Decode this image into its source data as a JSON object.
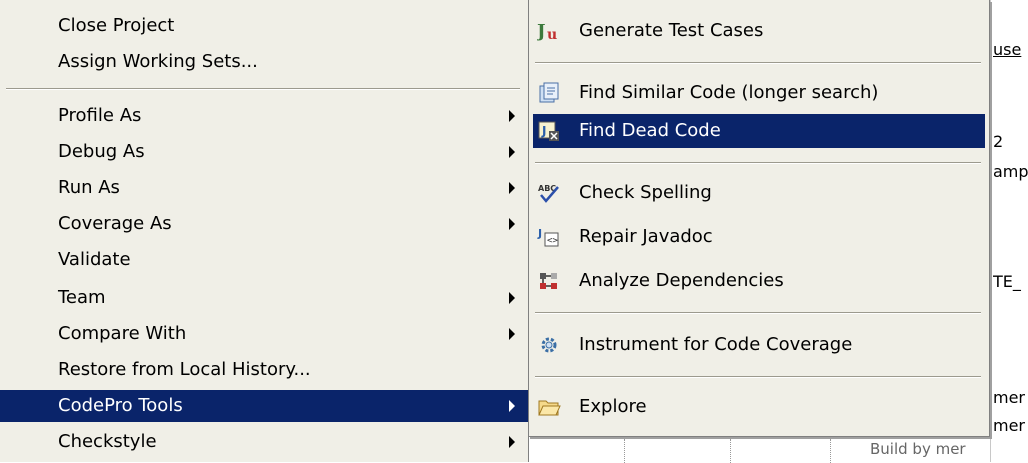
{
  "background": {
    "fragments": [
      "use",
      "2",
      "amp",
      "TE_",
      "mer",
      "mer"
    ],
    "bottom_text": "Build by mer"
  },
  "left_menu": {
    "items": [
      {
        "label": "Close Project"
      },
      {
        "label": "Assign Working Sets..."
      },
      {
        "label": "Profile As"
      },
      {
        "label": "Debug As"
      },
      {
        "label": "Run As"
      },
      {
        "label": "Coverage As"
      },
      {
        "label": "Validate"
      },
      {
        "label": "Team"
      },
      {
        "label": "Compare With"
      },
      {
        "label": "Restore from Local History..."
      },
      {
        "label": "CodePro Tools"
      },
      {
        "label": "Checkstyle"
      }
    ]
  },
  "submenu": {
    "items": [
      {
        "label": "Generate Test Cases",
        "icon": "junit-test-icon"
      },
      {
        "label": "Find Similar Code (longer search)",
        "icon": "similar-code-icon"
      },
      {
        "label": "Find Dead Code",
        "icon": "dead-code-icon"
      },
      {
        "label": "Check Spelling",
        "icon": "spell-check-icon"
      },
      {
        "label": "Repair Javadoc",
        "icon": "javadoc-repair-icon"
      },
      {
        "label": "Analyze Dependencies",
        "icon": "dependencies-icon"
      },
      {
        "label": "Instrument for Code Coverage",
        "icon": "gear-icon"
      },
      {
        "label": "Explore",
        "icon": "folder-icon"
      }
    ]
  },
  "colors": {
    "menu_bg": "#f0efe7",
    "selection": "#0a246a",
    "selection_text": "#ffffff"
  }
}
